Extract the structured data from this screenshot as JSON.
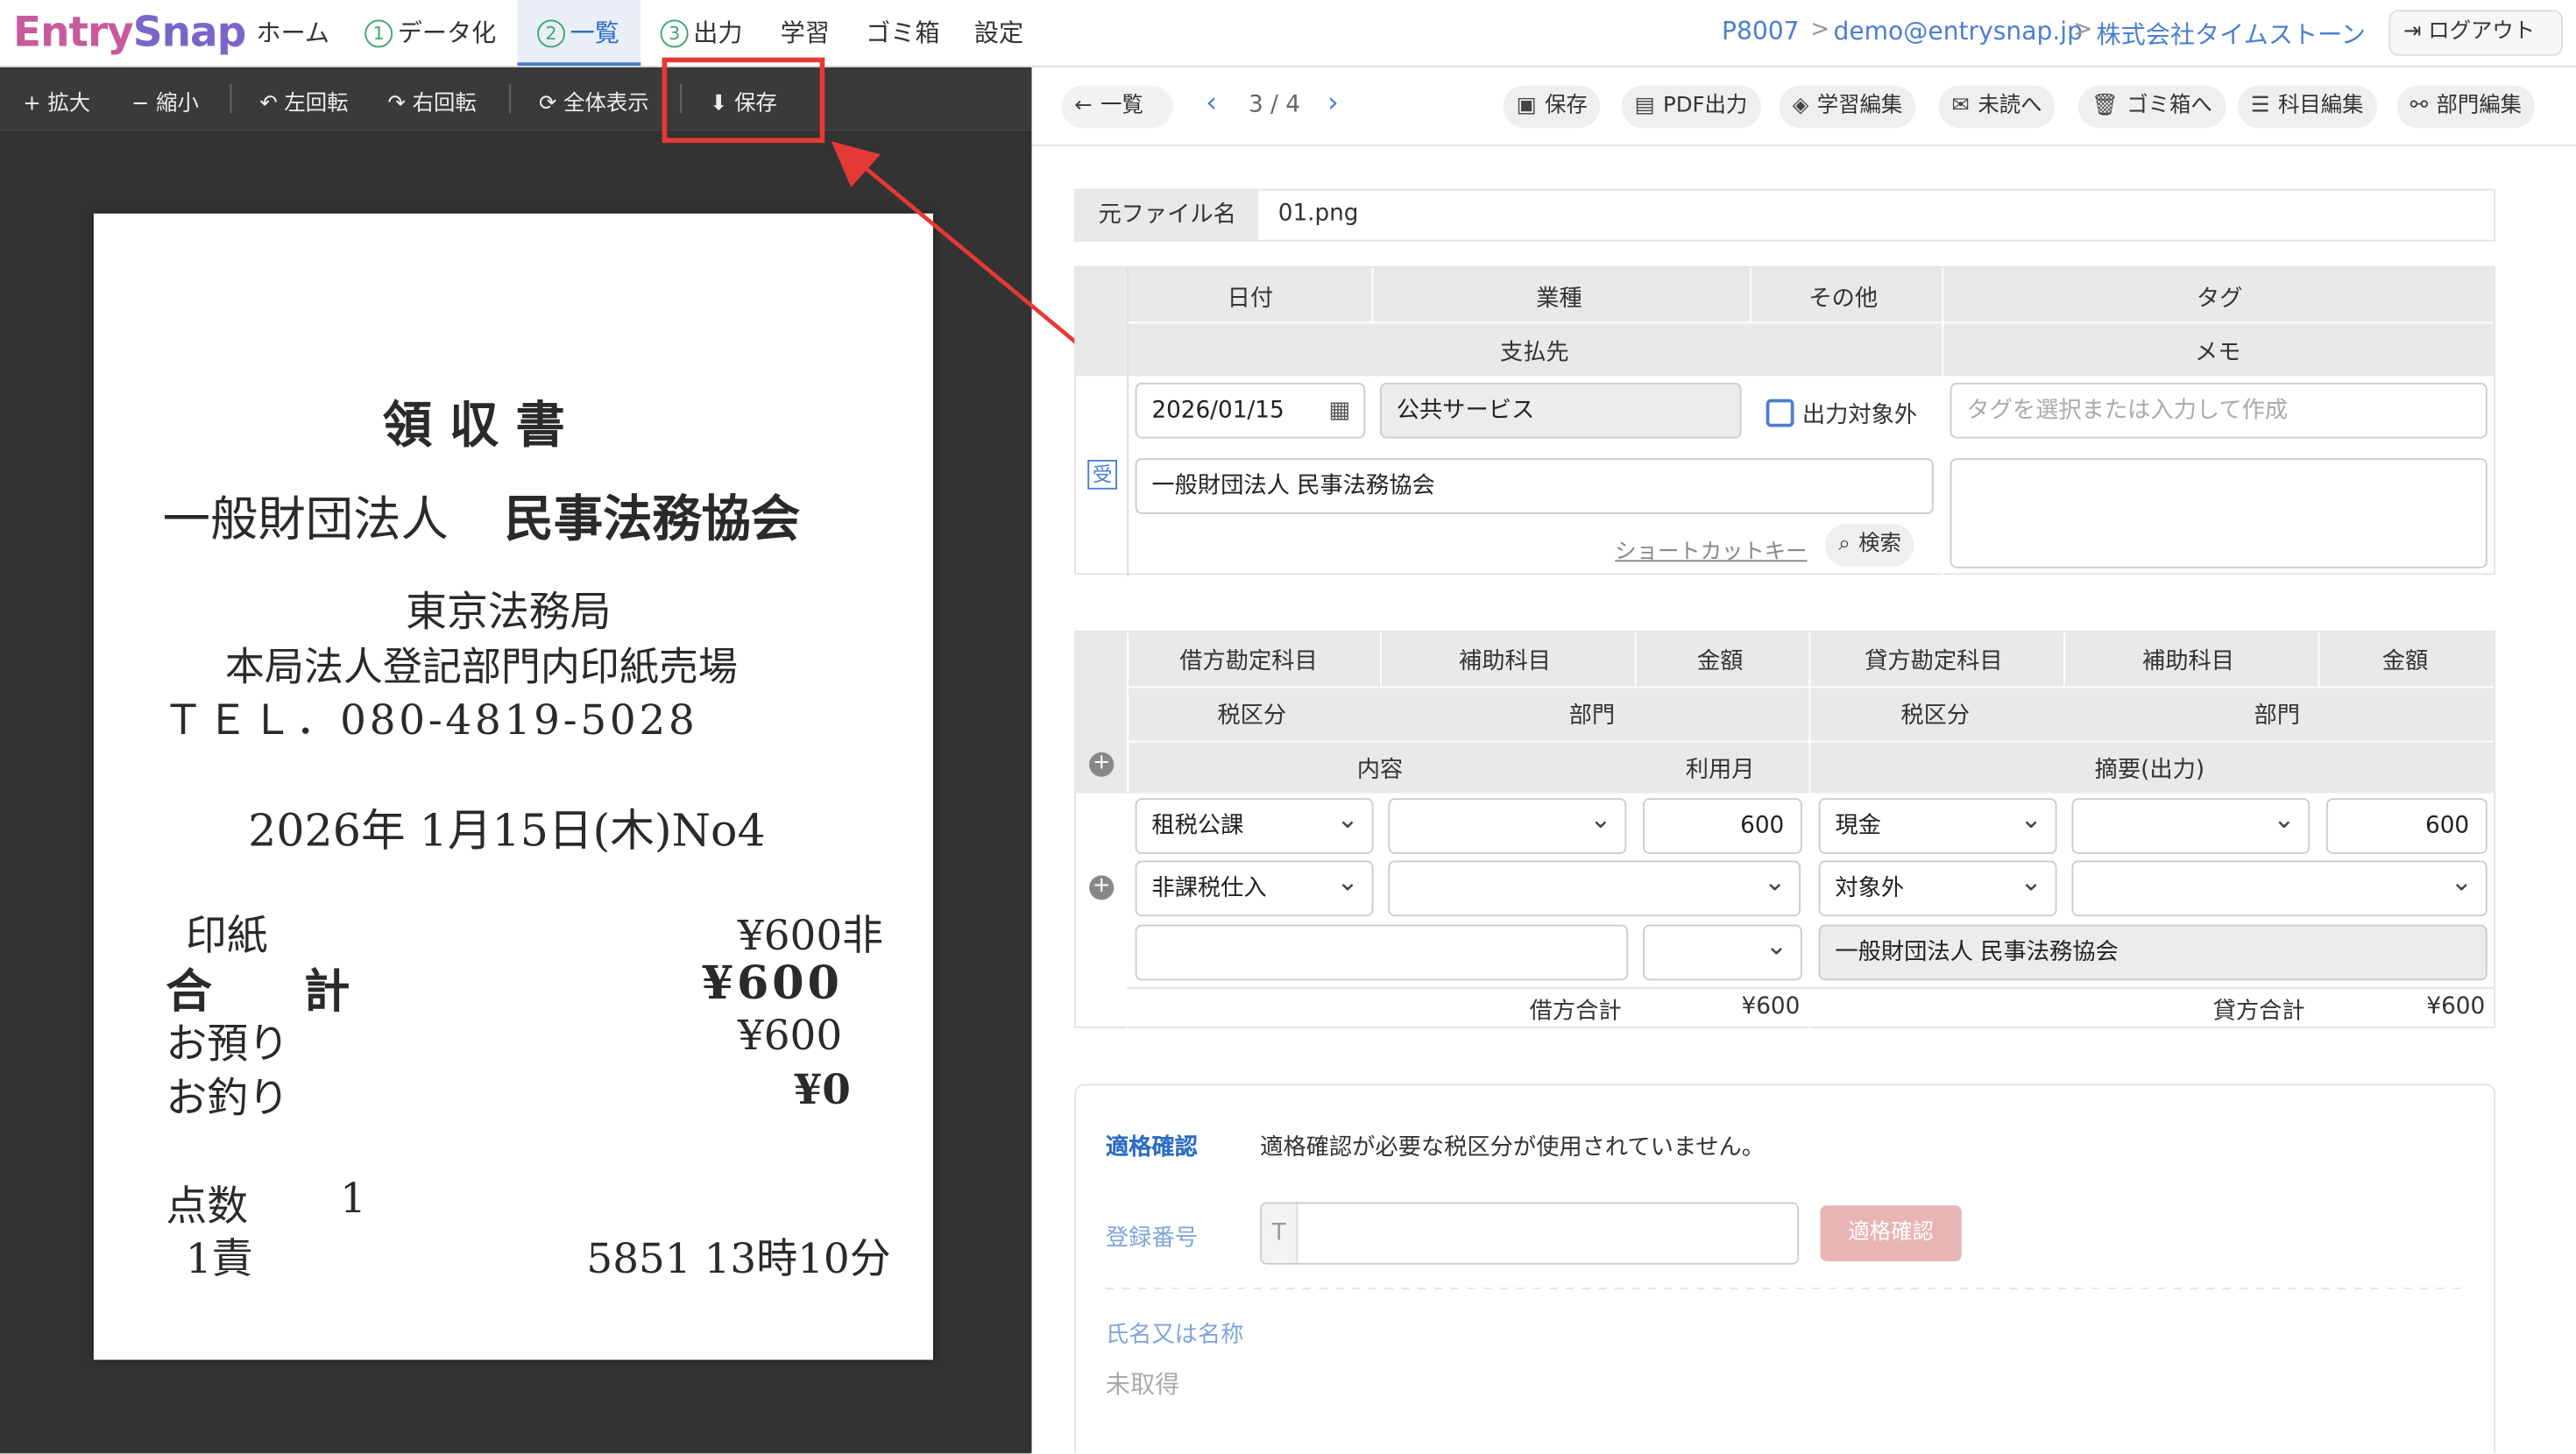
{
  "app": {
    "logo_a": "Entry",
    "logo_b": "Snap"
  },
  "nav": {
    "home": "ホーム",
    "num1": "1",
    "datafy": "データ化",
    "num2": "2",
    "list": "一覧",
    "num3": "3",
    "output": "出力",
    "learn": "学習",
    "trash": "ゴミ箱",
    "settings": "設定"
  },
  "breadcrumb": {
    "code": "P8007",
    "email": "demo@entrysnap.jp",
    "company": "株式会社タイムストーン",
    "sep": ">"
  },
  "logout": "ログアウト",
  "viewer_toolbar": {
    "zoom_in": "+ 拡大",
    "zoom_out": "− 縮小",
    "rotate_left": "↶ 左回転",
    "rotate_right": "↷ 右回転",
    "fit": "⟳ 全体表示",
    "save": "⬇ 保存"
  },
  "receipt": {
    "title": "領 収 書",
    "org": "一般財団法人",
    "org_name": "民事法務協会",
    "office": "東京法務局",
    "place": "本局法人登記部門内印紙売場",
    "tel": "ＴＥＬ．080-4819-5028",
    "date": "2026年 1月15日(木)No4",
    "item": "印紙",
    "item_price": "¥600非",
    "total_label": "合　　計",
    "total": "¥600",
    "deposit_label": "お預り",
    "deposit": "¥600",
    "change_label": "お釣り",
    "change": "¥0",
    "count_label": "点数",
    "count": "1",
    "staff": "1責",
    "code_time": "5851 13時10分"
  },
  "right_toolbar": {
    "back": "一覧",
    "page": "3 / 4",
    "save": "保存",
    "pdf": "PDF出力",
    "learn_edit": "学習編集",
    "unread": "未読へ",
    "to_trash": "ゴミ箱へ",
    "account_edit": "科目編集",
    "dept_edit": "部門編集"
  },
  "file": {
    "label": "元ファイル名",
    "value": "01.png"
  },
  "header_form": {
    "date_h": "日付",
    "industry_h": "業種",
    "other_h": "その他",
    "tag_h": "タグ",
    "payee_h": "支払先",
    "memo_h": "メモ",
    "date": "2026/01/15",
    "industry": "公共サービス",
    "exclude": "出力対象外",
    "tag_placeholder": "タグを選択または入力して作成",
    "badge": "受",
    "payee": "一般財団法人 民事法務協会",
    "shortcut": "ショートカットキー",
    "search": "検索"
  },
  "journal": {
    "h": {
      "debit": "借方勘定科目",
      "sub1": "補助科目",
      "amt1": "金額",
      "credit": "貸方勘定科目",
      "sub2": "補助科目",
      "amt2": "金額",
      "tax1": "税区分",
      "dept1": "部門",
      "tax2": "税区分",
      "dept2": "部門",
      "content": "内容",
      "month": "利用月",
      "summary": "摘要(出力)"
    },
    "debit": "租税公課",
    "debit_amount": "600",
    "credit": "現金",
    "credit_amount": "600",
    "debit_tax": "非課税仕入",
    "credit_tax": "対象外",
    "summary": "一般財団法人 民事法務協会",
    "debit_total_label": "借方合計",
    "debit_total": "¥600",
    "credit_total_label": "貸方合計",
    "credit_total": "¥600"
  },
  "qualification": {
    "title": "適格確認",
    "message": "適格確認が必要な税区分が使用されていません。",
    "reg_label": "登録番号",
    "reg_prefix": "T",
    "reg_button": "適格確認",
    "name_label": "氏名又は名称",
    "name_value": "未取得"
  }
}
